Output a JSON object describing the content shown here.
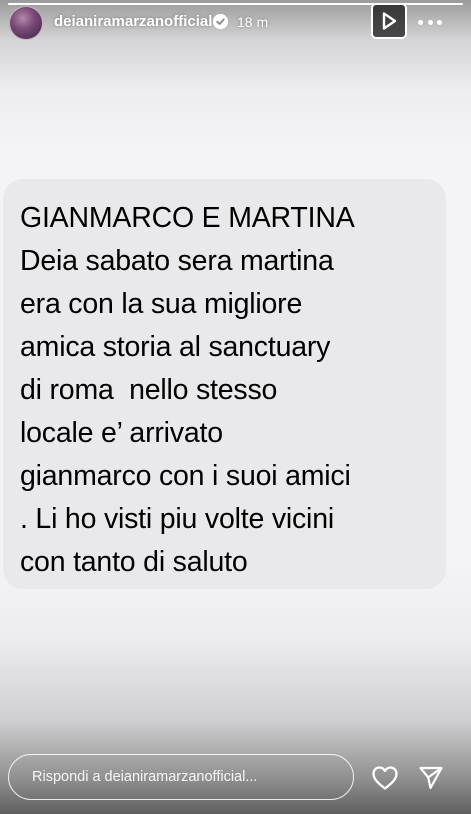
{
  "story": {
    "progress": 1.0,
    "username": "deianiramarzanofficial",
    "timestamp": "18 m",
    "verified": true
  },
  "message": {
    "lines": [
      "GIANMARCO E MARTINA",
      "Deia sabato sera martina",
      "era con la sua migliore",
      "amica storia al sanctuary",
      "di roma  nello stesso",
      "locale e’ arrivato",
      "gianmarco con i suoi amici",
      ". Li ho visti piu volte vicini",
      "con tanto di saluto"
    ]
  },
  "reply": {
    "placeholder": "Rispondi a deianiramarzanofficial..."
  },
  "icons": {
    "play": "play-icon",
    "more": "more-icon",
    "verified": "verified-badge-icon",
    "like": "heart-icon",
    "send": "send-icon"
  },
  "colors": {
    "bubble": "#e9e9eb",
    "text": "#000000",
    "overlay_text": "#ffffff"
  }
}
